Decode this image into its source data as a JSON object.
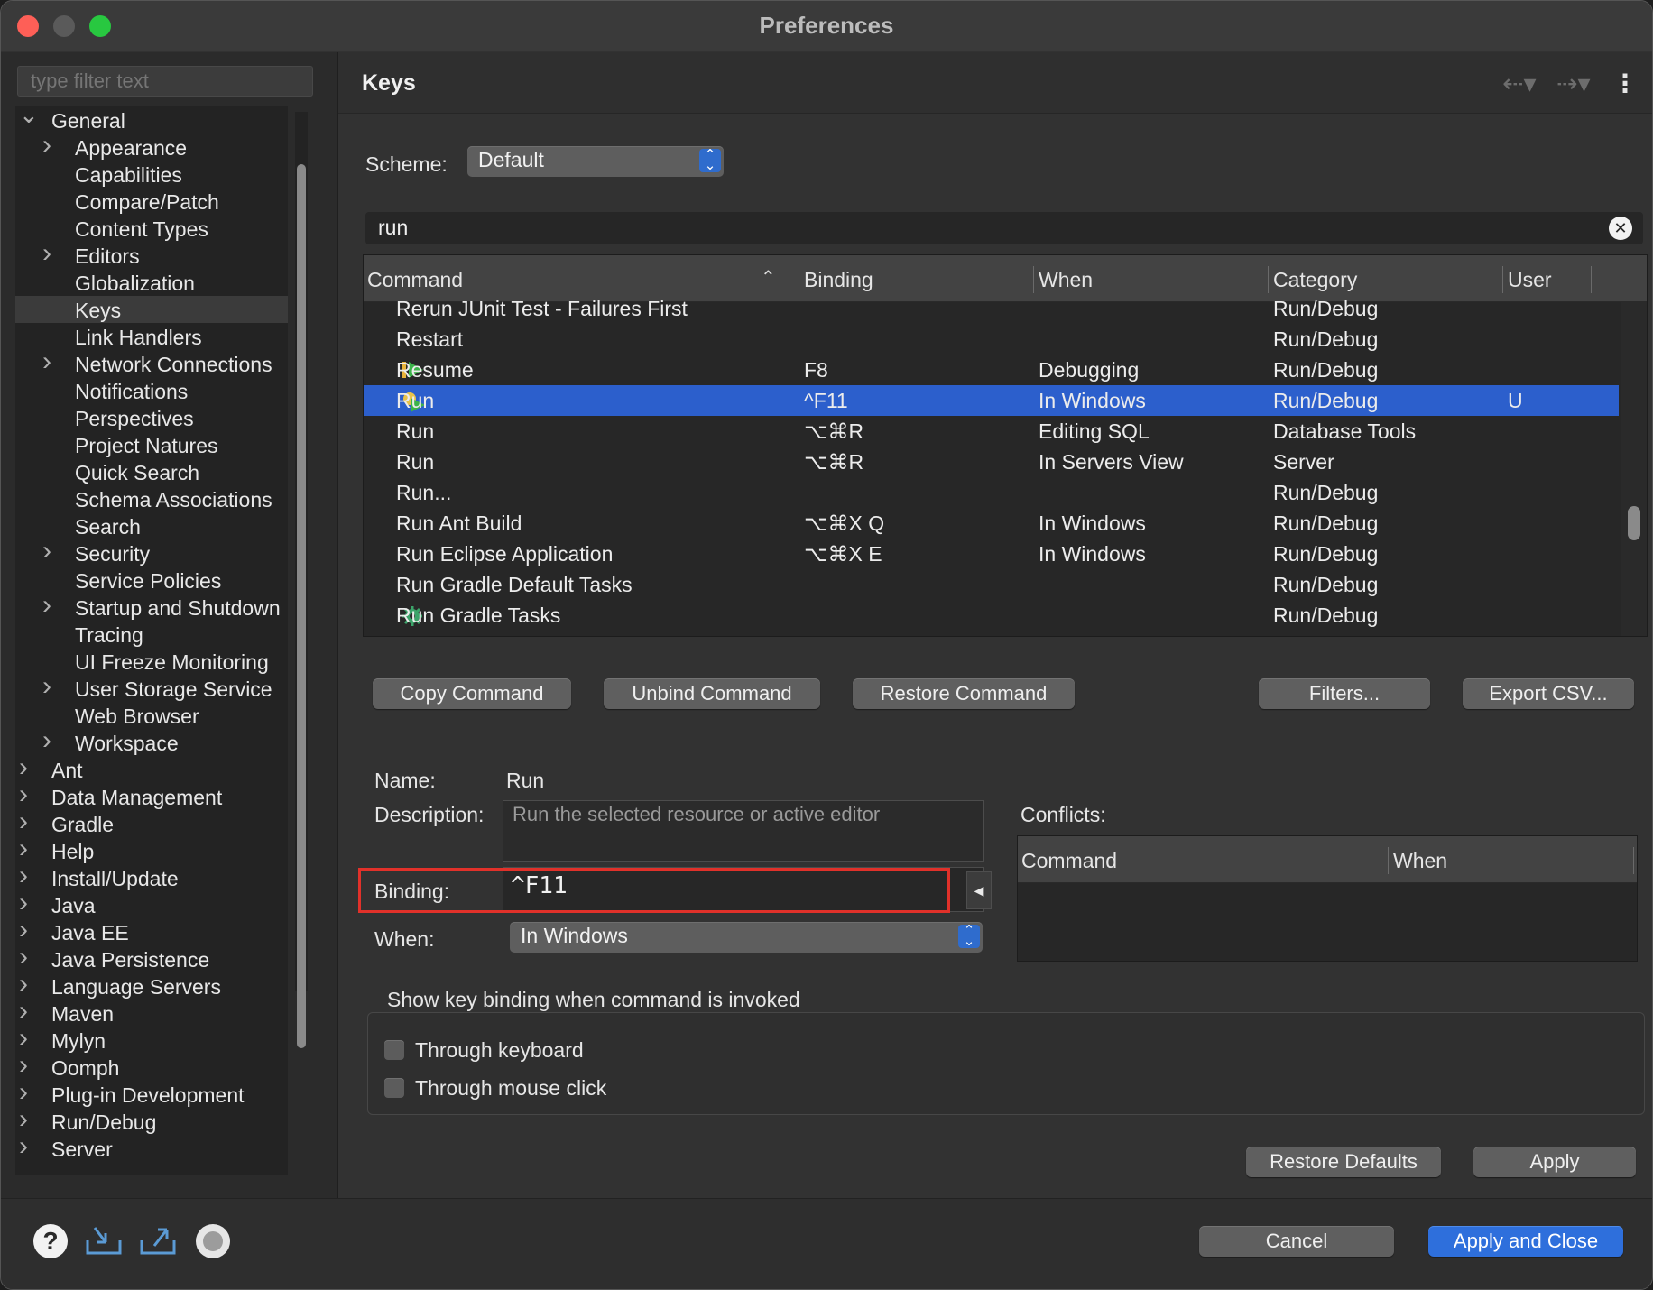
{
  "window": {
    "title": "Preferences"
  },
  "filter": {
    "placeholder": "type filter text"
  },
  "tree": [
    {
      "label": "General",
      "level": 0,
      "expander": "open"
    },
    {
      "label": "Appearance",
      "level": 1,
      "expander": "closed"
    },
    {
      "label": "Capabilities",
      "level": 1,
      "expander": "none"
    },
    {
      "label": "Compare/Patch",
      "level": 1,
      "expander": "none"
    },
    {
      "label": "Content Types",
      "level": 1,
      "expander": "none"
    },
    {
      "label": "Editors",
      "level": 1,
      "expander": "closed"
    },
    {
      "label": "Globalization",
      "level": 1,
      "expander": "none"
    },
    {
      "label": "Keys",
      "level": 1,
      "expander": "none",
      "selected": true
    },
    {
      "label": "Link Handlers",
      "level": 1,
      "expander": "none"
    },
    {
      "label": "Network Connections",
      "level": 1,
      "expander": "closed"
    },
    {
      "label": "Notifications",
      "level": 1,
      "expander": "none"
    },
    {
      "label": "Perspectives",
      "level": 1,
      "expander": "none"
    },
    {
      "label": "Project Natures",
      "level": 1,
      "expander": "none"
    },
    {
      "label": "Quick Search",
      "level": 1,
      "expander": "none"
    },
    {
      "label": "Schema Associations",
      "level": 1,
      "expander": "none"
    },
    {
      "label": "Search",
      "level": 1,
      "expander": "none"
    },
    {
      "label": "Security",
      "level": 1,
      "expander": "closed"
    },
    {
      "label": "Service Policies",
      "level": 1,
      "expander": "none"
    },
    {
      "label": "Startup and Shutdown",
      "level": 1,
      "expander": "closed"
    },
    {
      "label": "Tracing",
      "level": 1,
      "expander": "none"
    },
    {
      "label": "UI Freeze Monitoring",
      "level": 1,
      "expander": "none"
    },
    {
      "label": "User Storage Service",
      "level": 1,
      "expander": "closed"
    },
    {
      "label": "Web Browser",
      "level": 1,
      "expander": "none"
    },
    {
      "label": "Workspace",
      "level": 1,
      "expander": "closed"
    },
    {
      "label": "Ant",
      "level": 0,
      "expander": "closed"
    },
    {
      "label": "Data Management",
      "level": 0,
      "expander": "closed"
    },
    {
      "label": "Gradle",
      "level": 0,
      "expander": "closed"
    },
    {
      "label": "Help",
      "level": 0,
      "expander": "closed"
    },
    {
      "label": "Install/Update",
      "level": 0,
      "expander": "closed"
    },
    {
      "label": "Java",
      "level": 0,
      "expander": "closed"
    },
    {
      "label": "Java EE",
      "level": 0,
      "expander": "closed"
    },
    {
      "label": "Java Persistence",
      "level": 0,
      "expander": "closed"
    },
    {
      "label": "Language Servers",
      "level": 0,
      "expander": "closed"
    },
    {
      "label": "Maven",
      "level": 0,
      "expander": "closed"
    },
    {
      "label": "Mylyn",
      "level": 0,
      "expander": "closed"
    },
    {
      "label": "Oomph",
      "level": 0,
      "expander": "closed"
    },
    {
      "label": "Plug-in Development",
      "level": 0,
      "expander": "closed"
    },
    {
      "label": "Run/Debug",
      "level": 0,
      "expander": "closed"
    },
    {
      "label": "Server",
      "level": 0,
      "expander": "closed"
    }
  ],
  "page": {
    "title": "Keys",
    "scheme_label": "Scheme:",
    "scheme_value": "Default",
    "search_value": "run"
  },
  "table": {
    "columns": [
      "Command",
      "Binding",
      "When",
      "Category",
      "User"
    ],
    "rows": [
      {
        "command": "Rerun JUnit Test - Failures First",
        "binding": "",
        "when": "",
        "category": "Run/Debug",
        "user": "",
        "icon": ""
      },
      {
        "command": "Restart",
        "binding": "",
        "when": "",
        "category": "Run/Debug",
        "user": "",
        "icon": ""
      },
      {
        "command": "Resume",
        "binding": "F8",
        "when": "Debugging",
        "category": "Run/Debug",
        "user": "",
        "icon": "resume-icon"
      },
      {
        "command": "Run",
        "binding": "^F11",
        "when": "In Windows",
        "category": "Run/Debug",
        "user": "U",
        "icon": "run-icon",
        "selected": true
      },
      {
        "command": "Run",
        "binding": "⌥⌘R",
        "when": "Editing SQL",
        "category": "Database Tools",
        "user": "",
        "icon": ""
      },
      {
        "command": "Run",
        "binding": "⌥⌘R",
        "when": "In Servers View",
        "category": "Server",
        "user": "",
        "icon": ""
      },
      {
        "command": "Run...",
        "binding": "",
        "when": "",
        "category": "Run/Debug",
        "user": "",
        "icon": ""
      },
      {
        "command": "Run Ant Build",
        "binding": "⌥⌘X Q",
        "when": "In Windows",
        "category": "Run/Debug",
        "user": "",
        "icon": ""
      },
      {
        "command": "Run Eclipse Application",
        "binding": "⌥⌘X E",
        "when": "In Windows",
        "category": "Run/Debug",
        "user": "",
        "icon": ""
      },
      {
        "command": "Run Gradle Default Tasks",
        "binding": "",
        "when": "",
        "category": "Run/Debug",
        "user": "",
        "icon": ""
      },
      {
        "command": "Run Gradle Tasks",
        "binding": "",
        "when": "",
        "category": "Run/Debug",
        "user": "",
        "icon": "gear-icon"
      }
    ]
  },
  "actions": {
    "copy": "Copy Command",
    "unbind": "Unbind Command",
    "restore": "Restore Command",
    "filters": "Filters...",
    "export": "Export CSV..."
  },
  "details": {
    "name_label": "Name:",
    "name_value": "Run",
    "description_label": "Description:",
    "description_placeholder": "Run the selected resource or active editor",
    "binding_label": "Binding:",
    "binding_value": "^F11",
    "when_label": "When:",
    "when_value": "In Windows",
    "conflicts_label": "Conflicts:",
    "conflicts_columns": [
      "Command",
      "When"
    ]
  },
  "show_binding": {
    "title": "Show key binding when command is invoked",
    "through_keyboard": "Through keyboard",
    "through_mouse": "Through mouse click"
  },
  "footer": {
    "restore_defaults": "Restore Defaults",
    "apply": "Apply",
    "cancel": "Cancel",
    "apply_close": "Apply and Close"
  },
  "colors": {
    "selection": "#2c5fcc",
    "primary_button": "#2e6fdc",
    "highlight_border": "#e1312a"
  }
}
